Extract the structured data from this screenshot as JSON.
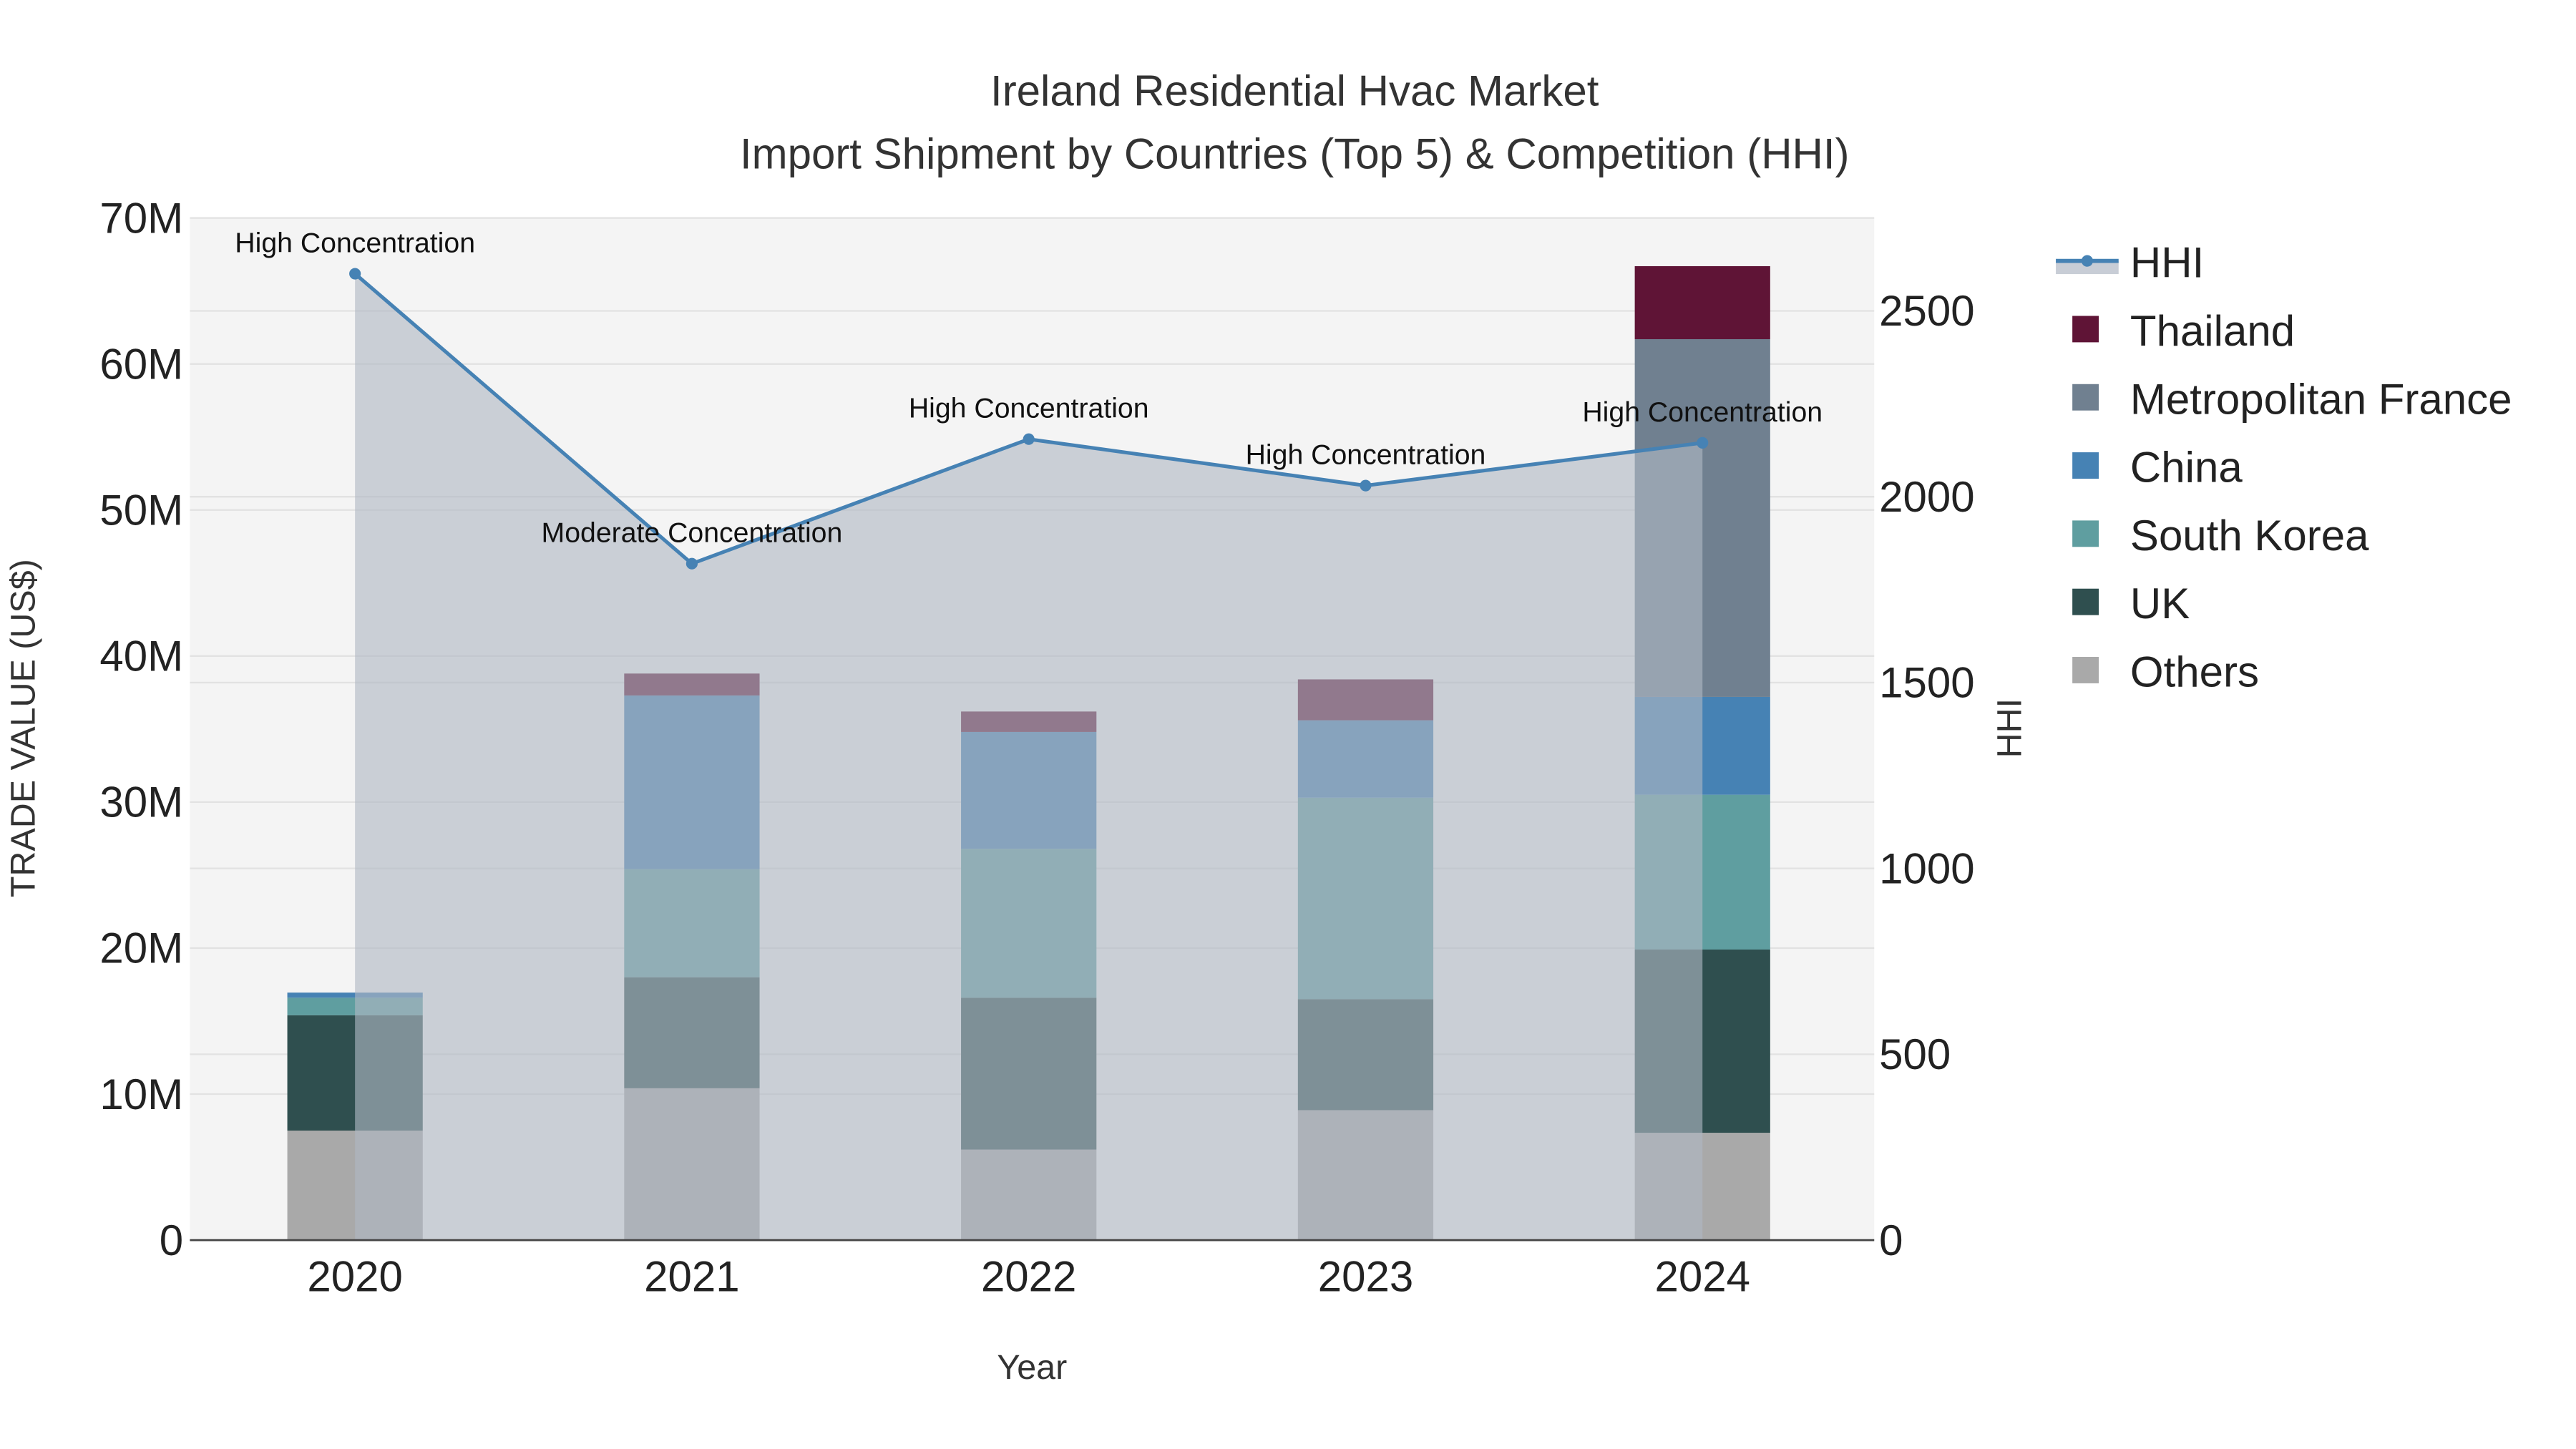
{
  "chart_data": {
    "type": "bar",
    "title": "Ireland Residential Hvac Market",
    "subtitle": "Import Shipment by Countries (Top 5) & Competition (HHI)",
    "xlabel": "Year",
    "ylabel": "TRADE VALUE (US$)",
    "y2label": "HHI",
    "ylim": [
      0,
      70000000
    ],
    "y2lim": [
      0,
      2750
    ],
    "yticks": [
      0,
      10000000,
      20000000,
      30000000,
      40000000,
      50000000,
      60000000,
      70000000
    ],
    "ytick_labels": [
      "0",
      "10M",
      "20M",
      "30M",
      "40M",
      "50M",
      "60M",
      "70M"
    ],
    "y2ticks": [
      0,
      500,
      1000,
      1500,
      2000,
      2500
    ],
    "y2tick_labels": [
      "0",
      "500",
      "1000",
      "1500",
      "2000",
      "2500"
    ],
    "categories": [
      "2020",
      "2021",
      "2022",
      "2023",
      "2024"
    ],
    "stacked": true,
    "grid": true,
    "legend_position": "right",
    "series": [
      {
        "name": "Others",
        "color": "#a9a9a9",
        "values": [
          7500000,
          10400000,
          6200000,
          8900000,
          7350000
        ]
      },
      {
        "name": "UK",
        "color": "#2f4f4f",
        "values": [
          7900000,
          7600000,
          10400000,
          7600000,
          12550000
        ]
      },
      {
        "name": "South Korea",
        "color": "#5f9ea0",
        "values": [
          1200000,
          7400000,
          10200000,
          13800000,
          10600000
        ]
      },
      {
        "name": "China",
        "color": "#4682b4",
        "values": [
          350000,
          11900000,
          8000000,
          5300000,
          6700000
        ]
      },
      {
        "name": "Metropolitan France",
        "color": "#708090",
        "values": [
          0,
          0,
          0,
          0,
          24500000
        ]
      },
      {
        "name": "Thailand",
        "color": "#5f1436",
        "values": [
          0,
          1500000,
          1400000,
          2800000,
          5000000
        ]
      }
    ],
    "hhi": {
      "name": "HHI",
      "color": "#4682b4",
      "values": [
        2600,
        1820,
        2155,
        2030,
        2145
      ],
      "annotations": [
        "High Concentration",
        "Moderate Concentration",
        "High Concentration",
        "High Concentration",
        "High Concentration"
      ]
    },
    "legend_order": [
      "HHI",
      "Thailand",
      "Metropolitan France",
      "China",
      "South Korea",
      "UK",
      "Others"
    ]
  }
}
